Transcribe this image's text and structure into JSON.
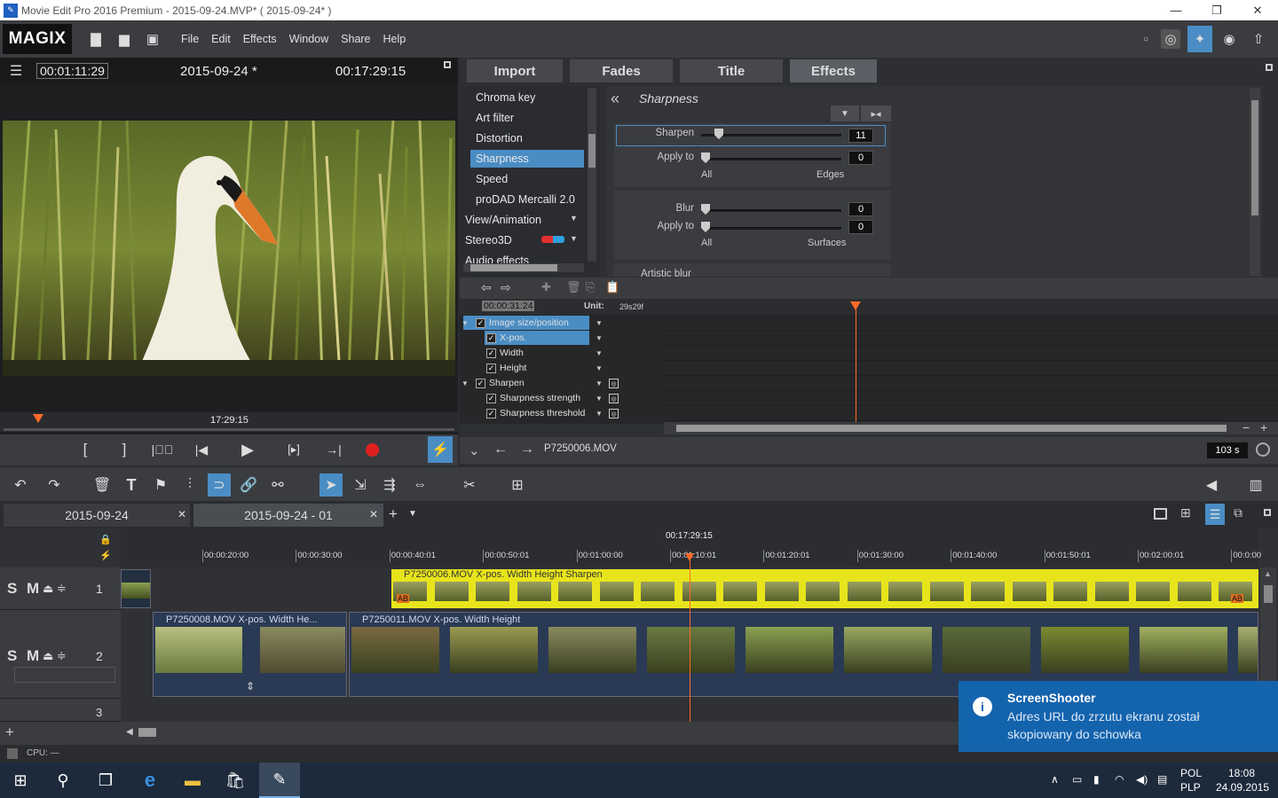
{
  "window": {
    "title": "Movie Edit Pro 2016 Premium - 2015-09-24.MVP* ( 2015-09-24* )"
  },
  "menubar": {
    "logo": "MAGIX",
    "items": [
      "File",
      "Edit",
      "Effects",
      "Window",
      "Share",
      "Help"
    ]
  },
  "preview": {
    "timecode_current": "00:01:11:29",
    "project_name": "2015-09-24 *",
    "timecode_total": "00:17:29:15",
    "scrub_time": "17:29:15",
    "image_subject": "swan among reeds"
  },
  "effects_panel": {
    "tabs": [
      "Import",
      "Fades",
      "Title",
      "Effects"
    ],
    "active_tab": "Effects",
    "list": [
      "Chroma key",
      "Art filter",
      "Distortion",
      "Sharpness",
      "Speed",
      "proDAD Mercalli 2.0",
      "View/Animation",
      "Stereo3D",
      "Audio effects"
    ],
    "selected": "Sharpness",
    "heading": "Sharpness",
    "sharpen": {
      "label": "Sharpen",
      "value": "11",
      "level": 0.1
    },
    "apply_to_1": {
      "label": "Apply to",
      "value": "0",
      "left": "All",
      "right": "Edges"
    },
    "blur": {
      "label": "Blur",
      "value": "0"
    },
    "apply_to_2": {
      "label": "Apply to",
      "value": "0",
      "left": "All",
      "right": "Surfaces"
    },
    "next_section": "Artistic blur"
  },
  "keyframes": {
    "timecode": "00:00:31:24",
    "unit_label": "Unit:",
    "unit_value": "29s29f",
    "rows": [
      {
        "label": "Image size/position",
        "indent": 0,
        "expand": true,
        "selected": true,
        "marker": false
      },
      {
        "label": "X-pos.",
        "indent": 1,
        "expand": false,
        "selected": true,
        "marker": false
      },
      {
        "label": "Width",
        "indent": 1,
        "expand": false,
        "selected": false,
        "marker": false
      },
      {
        "label": "Height",
        "indent": 1,
        "expand": false,
        "selected": false,
        "marker": false
      },
      {
        "label": "Sharpen",
        "indent": 0,
        "expand": true,
        "selected": false,
        "marker": true
      },
      {
        "label": "Sharpness strength",
        "indent": 1,
        "expand": false,
        "selected": false,
        "marker": true
      },
      {
        "label": "Sharpness threshold",
        "indent": 1,
        "expand": false,
        "selected": false,
        "marker": true
      }
    ],
    "clip_name": "P7250006.MOV",
    "zoom": "103 s"
  },
  "arranger": {
    "project_tabs": [
      "2015-09-24",
      "2015-09-24 - 01"
    ],
    "position": "00:17:29:15",
    "ruler": [
      "00:00:20:00",
      "00:00:30:00",
      "00:00:40:01",
      "00:00:50:01",
      "00:01:00:00",
      "00:01:10:01",
      "00:01:20:01",
      "00:01:30:00",
      "00:01:40:00",
      "00:01:50:01",
      "00:02:00:01",
      "00:0:00"
    ],
    "track1": {
      "number": "1",
      "clip_label": "P7250006.MOV   X-pos.   Width   Height   Sharpen"
    },
    "track2": {
      "number": "2",
      "clip1": "P7250008.MOV   X-pos.   Width   He...",
      "clip2": "P7250011.MOV   X-pos.   Width   Height"
    },
    "track3": {
      "number": "3"
    },
    "sm": "S M",
    "cpu": "CPU: —"
  },
  "toast": {
    "title": "ScreenShooter",
    "body": "Adres URL do zrzutu ekranu został skopiowany do schowka"
  },
  "taskbar": {
    "lang1": "POL",
    "lang2": "PLP",
    "time": "18:08",
    "date": "24.09.2015"
  },
  "colors": {
    "accent_blue": "#4a8dc4",
    "clip_yellow": "#e8e41c",
    "playhead": "#ff6a2a",
    "toast_bg": "#1463ad"
  }
}
